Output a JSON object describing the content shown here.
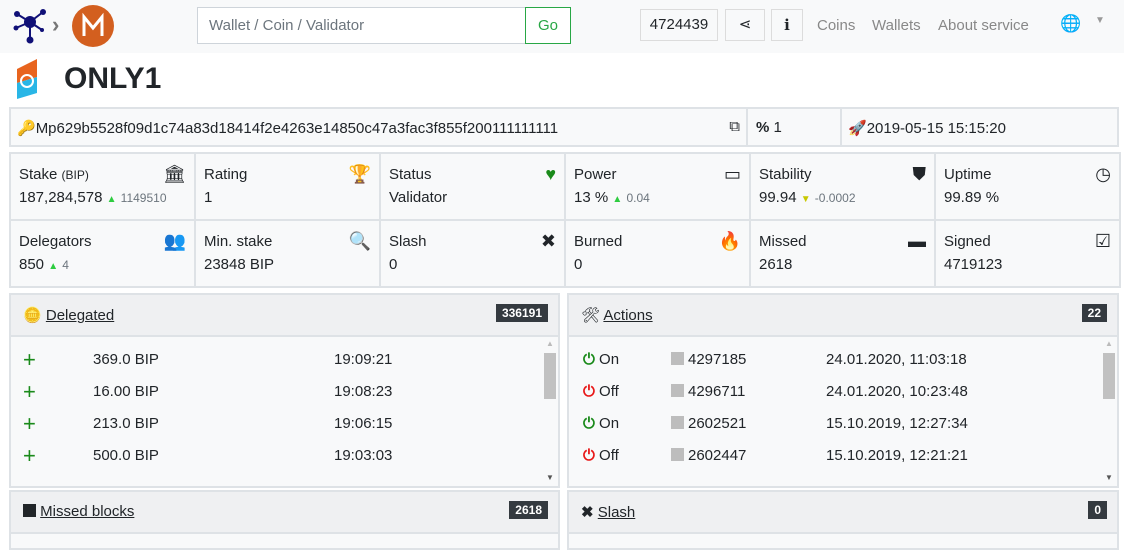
{
  "nav": {
    "search_placeholder": "Wallet / Coin / Validator",
    "go": "Go",
    "block": "4724439",
    "links": [
      "Coins",
      "Wallets",
      "About service"
    ]
  },
  "validator": {
    "name": "ONLY1",
    "address": "Mp629b5528f09d1c74a83d18414f2e4263e14850c47a3fac3f855f200111111111",
    "commission": "1",
    "created": "2019-05-15 15:15:20"
  },
  "stats": [
    {
      "label": "Stake",
      "unit": "(BIP)",
      "value": "187,284,578",
      "delta": "1149510",
      "dir": "up",
      "icon": "bank-icon",
      "glyph": "🏛"
    },
    {
      "label": "Rating",
      "value": "1",
      "icon": "trophy-icon",
      "glyph": "🏆"
    },
    {
      "label": "Status",
      "value": "Validator",
      "icon": "heartbeat-icon",
      "glyph": "♥"
    },
    {
      "label": "Power",
      "value": "13 %",
      "delta": "0.04",
      "dir": "up",
      "icon": "battery-icon",
      "glyph": "▭"
    },
    {
      "label": "Stability",
      "value": "99.94",
      "delta": "-0.0002",
      "dir": "down",
      "icon": "shield-icon",
      "glyph": "⛊"
    },
    {
      "label": "Uptime",
      "value": "99.89 %",
      "icon": "clock-icon",
      "glyph": "◷"
    },
    {
      "label": "Delegators",
      "value": "850",
      "delta": "4",
      "dir": "up",
      "icon": "users-icon",
      "glyph": "👥"
    },
    {
      "label": "Min. stake",
      "value": "23848 BIP",
      "icon": "search-icon",
      "glyph": "🔍"
    },
    {
      "label": "Slash",
      "value": "0",
      "icon": "times-icon",
      "glyph": "✖"
    },
    {
      "label": "Burned",
      "value": "0",
      "icon": "fire-icon",
      "glyph": "🔥"
    },
    {
      "label": "Missed",
      "value": "2618",
      "icon": "minus-square-icon",
      "glyph": "▬"
    },
    {
      "label": "Signed",
      "value": "4719123",
      "icon": "check-square-icon",
      "glyph": "☑"
    }
  ],
  "delegated": {
    "title": "Delegated",
    "count": "336191",
    "rows": [
      {
        "amount": "369.0 BIP",
        "time": "19:09:21"
      },
      {
        "amount": "16.00 BIP",
        "time": "19:08:23"
      },
      {
        "amount": "213.0 BIP",
        "time": "19:06:15"
      },
      {
        "amount": "500.0 BIP",
        "time": "19:03:03"
      }
    ]
  },
  "actions": {
    "title": "Actions",
    "count": "22",
    "rows": [
      {
        "state": "On",
        "block": "4297185",
        "time": "24.01.2020, 11:03:18"
      },
      {
        "state": "Off",
        "block": "4296711",
        "time": "24.01.2020, 10:23:48"
      },
      {
        "state": "On",
        "block": "2602521",
        "time": "15.10.2019, 12:27:34"
      },
      {
        "state": "Off",
        "block": "2602447",
        "time": "15.10.2019, 12:21:21"
      }
    ]
  },
  "missed": {
    "title": "Missed blocks",
    "count": "2618"
  },
  "slash": {
    "title": "Slash",
    "count": "0"
  },
  "colors": {
    "green": "#1a8a1a",
    "red": "#e81818",
    "brand": "#d35f1f"
  }
}
